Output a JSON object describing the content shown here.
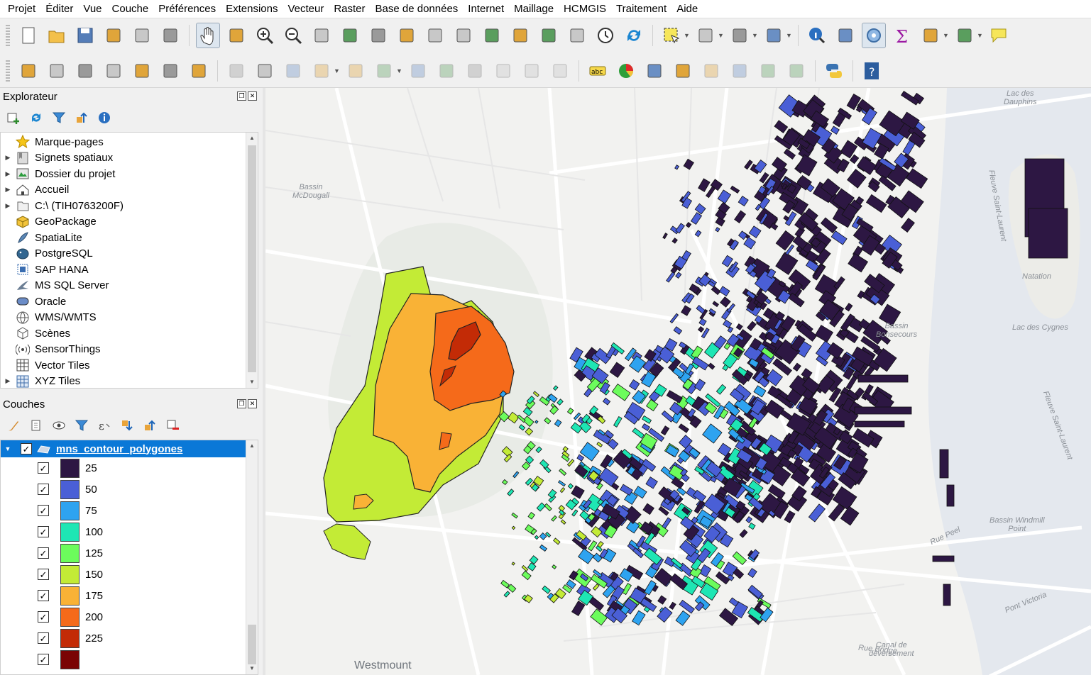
{
  "menu": [
    "Projet",
    "Éditer",
    "Vue",
    "Couche",
    "Préférences",
    "Extensions",
    "Vecteur",
    "Raster",
    "Base de données",
    "Internet",
    "Maillage",
    "HCMGIS",
    "Traitement",
    "Aide"
  ],
  "toolbar1": [
    "new-project",
    "open-project",
    "save-project",
    "new-print-layout",
    "layout-manager",
    "style-manager",
    "pan",
    "pan-to-selection",
    "zoom-in",
    "zoom-out",
    "zoom-full",
    "zoom-to-selection",
    "zoom-to-layer",
    "zoom-native",
    "zoom-last",
    "zoom-next",
    "new-map-view",
    "new-3d-view",
    "new-bookmark",
    "show-bookmarks",
    "temporal-controller",
    "refresh",
    "select-features",
    "attribute-form",
    "deselect",
    "select-location",
    "identify",
    "attribute-table",
    "processing-toolbox",
    "statistics",
    "field-calculator",
    "measure",
    "annotation"
  ],
  "toolbar2": [
    "add-vector-layer",
    "add-geopackage",
    "new-shapefile",
    "new-spatialite",
    "new-virtual",
    "new-mesh",
    "new-temp-scratch",
    "digitize",
    "toggle-editing",
    "save-edits",
    "add-feature",
    "vertex-tool",
    "modify-attributes",
    "delete-selected",
    "cut-features",
    "copy-features",
    "paste-features",
    "undo",
    "redo",
    "label-tool",
    "diagram-tool",
    "pin-labels",
    "highlight-labels",
    "show-hide-labels",
    "move-label",
    "rotate-label",
    "change-label",
    "python-console",
    "help"
  ],
  "explorer": {
    "title": "Explorateur",
    "items": [
      {
        "label": "Marque-pages",
        "icon": "star-icon",
        "expandable": false
      },
      {
        "label": "Signets spatiaux",
        "icon": "bookmark-icon",
        "expandable": true
      },
      {
        "label": "Dossier du projet",
        "icon": "project-folder-icon",
        "expandable": true
      },
      {
        "label": "Accueil",
        "icon": "home-icon",
        "expandable": true
      },
      {
        "label": "C:\\ (TIH0763200F)",
        "icon": "drive-icon",
        "expandable": true
      },
      {
        "label": "GeoPackage",
        "icon": "geopackage-icon",
        "expandable": false
      },
      {
        "label": "SpatiaLite",
        "icon": "spatialite-icon",
        "expandable": false
      },
      {
        "label": "PostgreSQL",
        "icon": "postgresql-icon",
        "expandable": false
      },
      {
        "label": "SAP HANA",
        "icon": "sap-hana-icon",
        "expandable": false
      },
      {
        "label": "MS SQL Server",
        "icon": "mssql-icon",
        "expandable": false
      },
      {
        "label": "Oracle",
        "icon": "oracle-icon",
        "expandable": false
      },
      {
        "label": "WMS/WMTS",
        "icon": "wms-icon",
        "expandable": false
      },
      {
        "label": "Scènes",
        "icon": "scenes-icon",
        "expandable": false
      },
      {
        "label": "SensorThings",
        "icon": "sensorthings-icon",
        "expandable": false
      },
      {
        "label": "Vector Tiles",
        "icon": "vector-tiles-icon",
        "expandable": false
      },
      {
        "label": "XYZ Tiles",
        "icon": "xyz-tiles-icon",
        "expandable": true
      }
    ]
  },
  "layers": {
    "title": "Couches",
    "layer_name": "mns_contour_polygones",
    "classes": [
      {
        "label": "25",
        "color": "#2d1743"
      },
      {
        "label": "50",
        "color": "#4a5fd6"
      },
      {
        "label": "75",
        "color": "#2ea3f0"
      },
      {
        "label": "100",
        "color": "#1ee6b4"
      },
      {
        "label": "125",
        "color": "#6cfc5c"
      },
      {
        "label": "150",
        "color": "#c3eb36"
      },
      {
        "label": "175",
        "color": "#f9b236"
      },
      {
        "label": "200",
        "color": "#f56a1a"
      },
      {
        "label": "225",
        "color": "#c32b06"
      },
      {
        "label": "",
        "color": "#7a0404"
      }
    ]
  },
  "map": {
    "labels": [
      {
        "text": "Bassin\nMcDougall"
      },
      {
        "text": "Lac des\nDauphins"
      },
      {
        "text": "Fleuve Saint-Laurent"
      },
      {
        "text": "Natation"
      },
      {
        "text": "Lac des Cygnes"
      },
      {
        "text": "Bassin\nBonsecours"
      },
      {
        "text": "Fleuve Saint-Laurent"
      },
      {
        "text": "Bassin Windmill\nPoint"
      },
      {
        "text": "Rue Peel"
      },
      {
        "text": "Pont Victoria"
      },
      {
        "text": "Canal de\ndéversement"
      },
      {
        "text": "Rue Bridge"
      },
      {
        "text": "Westmount"
      }
    ]
  }
}
